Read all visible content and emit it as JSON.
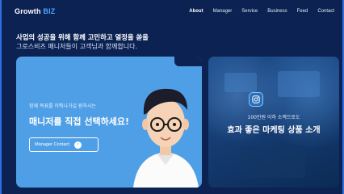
{
  "header": {
    "logo_main": "rowth",
    "logo_prefix": "G",
    "logo_accent": "BIZ",
    "nav": [
      "About",
      "Manager",
      "Service",
      "Business",
      "Feed",
      "Contact"
    ],
    "active_nav": "About"
  },
  "hero": {
    "headline": "사업의 성공을 위해 함께 고민하고 열정을 쏟을",
    "subline": "그로스비즈 매니저들이 고객님과 함께합니다."
  },
  "manager_card": {
    "sub": "함께 목표를 이뤄나가길 원하시는",
    "title": "매니저를 직접 선택하세요!",
    "button_label": "Manager Contact",
    "button_icon": "arrow-right-circle-icon"
  },
  "product_card": {
    "sub": "100만원 이하 소액으로도",
    "title": "효과 좋은 마케팅 상품 소개",
    "icon": "instagram-icon"
  },
  "colors": {
    "background": "#0b2252",
    "accent": "#4ea6ff",
    "manager_card": "#4f9fe6"
  }
}
